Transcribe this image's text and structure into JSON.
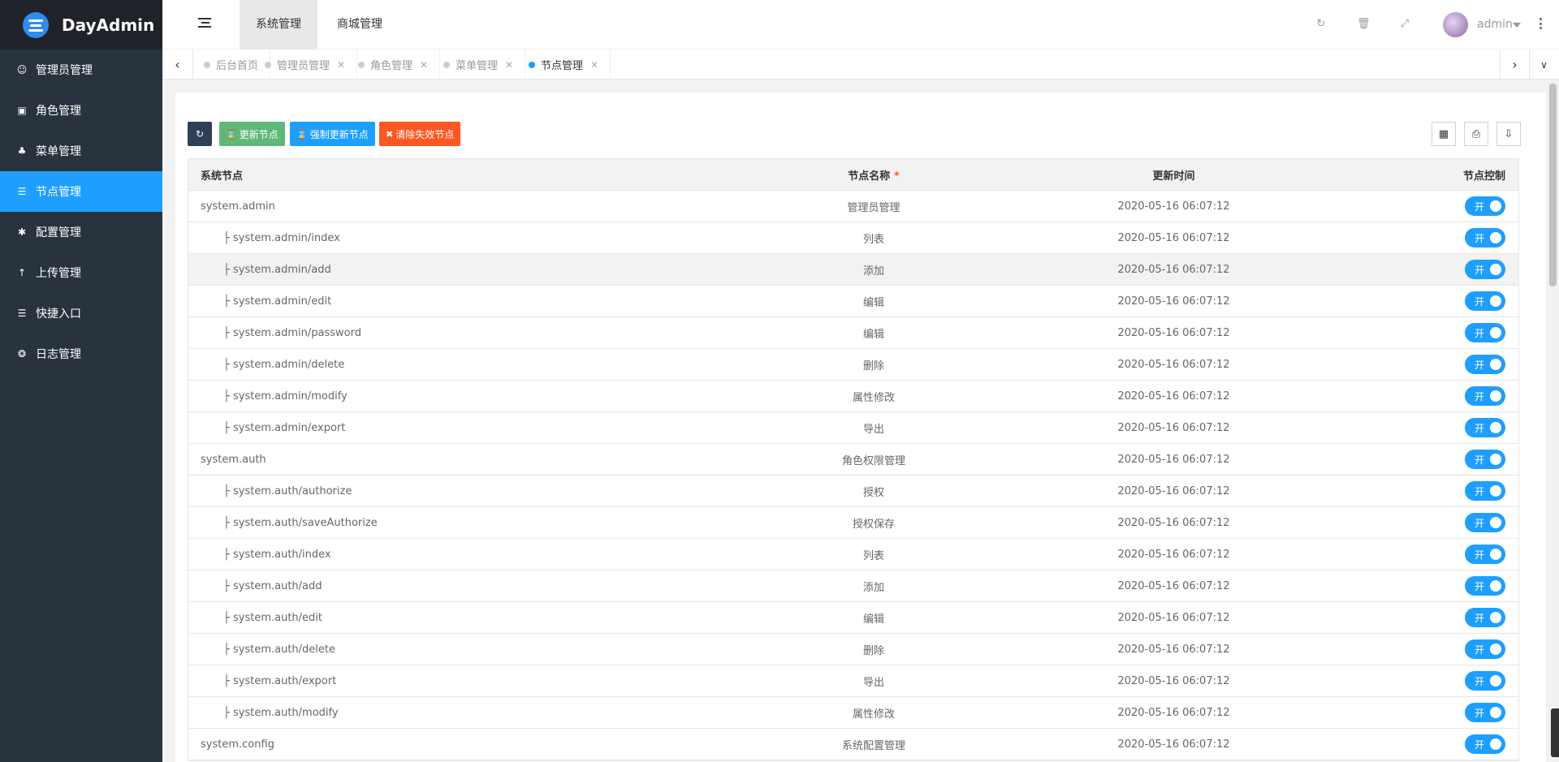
{
  "app": {
    "title": "DayAdmin"
  },
  "sidebar": {
    "items": [
      {
        "label": "管理员管理",
        "icon": "user-icon",
        "glyph": "☺"
      },
      {
        "label": "角色管理",
        "icon": "role-icon",
        "glyph": "▣"
      },
      {
        "label": "菜单管理",
        "icon": "tree-icon",
        "glyph": "♣"
      },
      {
        "label": "节点管理",
        "icon": "list-icon",
        "glyph": "☰",
        "active": true
      },
      {
        "label": "配置管理",
        "icon": "asterisk-icon",
        "glyph": "✱"
      },
      {
        "label": "上传管理",
        "icon": "upload-icon",
        "glyph": "↑"
      },
      {
        "label": "快捷入口",
        "icon": "list-icon",
        "glyph": "☰"
      },
      {
        "label": "日志管理",
        "icon": "globe-icon",
        "glyph": "❂"
      }
    ]
  },
  "header": {
    "tabs": [
      {
        "label": "系统管理",
        "active": true
      },
      {
        "label": "商城管理",
        "active": false
      }
    ],
    "user": {
      "name": "admin"
    }
  },
  "page_tabs": [
    {
      "label": "后台首页",
      "closable": false,
      "active": false
    },
    {
      "label": "管理员管理",
      "closable": true,
      "active": false
    },
    {
      "label": "角色管理",
      "closable": true,
      "active": false
    },
    {
      "label": "菜单管理",
      "closable": true,
      "active": false
    },
    {
      "label": "节点管理",
      "closable": true,
      "active": true
    }
  ],
  "toolbar": {
    "update_label": "更新节点",
    "force_update_label": "强制更新节点",
    "clear_label": "清除失效节点"
  },
  "table": {
    "columns": [
      "系统节点",
      "节点名称",
      "更新时间",
      "节点控制"
    ],
    "required_mark": "*",
    "switch_label": "开",
    "tree_prefix": "├",
    "rows": [
      {
        "node": "system.admin",
        "name": "管理员管理",
        "time": "2020-05-16 06:07:12",
        "child": false
      },
      {
        "node": "system.admin/index",
        "name": "列表",
        "time": "2020-05-16 06:07:12",
        "child": true
      },
      {
        "node": "system.admin/add",
        "name": "添加",
        "time": "2020-05-16 06:07:12",
        "child": true,
        "hover": true
      },
      {
        "node": "system.admin/edit",
        "name": "编辑",
        "time": "2020-05-16 06:07:12",
        "child": true
      },
      {
        "node": "system.admin/password",
        "name": "编辑",
        "time": "2020-05-16 06:07:12",
        "child": true
      },
      {
        "node": "system.admin/delete",
        "name": "删除",
        "time": "2020-05-16 06:07:12",
        "child": true
      },
      {
        "node": "system.admin/modify",
        "name": "属性修改",
        "time": "2020-05-16 06:07:12",
        "child": true
      },
      {
        "node": "system.admin/export",
        "name": "导出",
        "time": "2020-05-16 06:07:12",
        "child": true
      },
      {
        "node": "system.auth",
        "name": "角色权限管理",
        "time": "2020-05-16 06:07:12",
        "child": false
      },
      {
        "node": "system.auth/authorize",
        "name": "授权",
        "time": "2020-05-16 06:07:12",
        "child": true
      },
      {
        "node": "system.auth/saveAuthorize",
        "name": "授权保存",
        "time": "2020-05-16 06:07:12",
        "child": true
      },
      {
        "node": "system.auth/index",
        "name": "列表",
        "time": "2020-05-16 06:07:12",
        "child": true
      },
      {
        "node": "system.auth/add",
        "name": "添加",
        "time": "2020-05-16 06:07:12",
        "child": true
      },
      {
        "node": "system.auth/edit",
        "name": "编辑",
        "time": "2020-05-16 06:07:12",
        "child": true
      },
      {
        "node": "system.auth/delete",
        "name": "删除",
        "time": "2020-05-16 06:07:12",
        "child": true
      },
      {
        "node": "system.auth/export",
        "name": "导出",
        "time": "2020-05-16 06:07:12",
        "child": true
      },
      {
        "node": "system.auth/modify",
        "name": "属性修改",
        "time": "2020-05-16 06:07:12",
        "child": true
      },
      {
        "node": "system.config",
        "name": "系统配置管理",
        "time": "2020-05-16 06:07:12",
        "child": false
      }
    ]
  },
  "colors": {
    "sidebar_bg": "#28333e",
    "logo_bg": "#20222a",
    "accent": "#1e9fff",
    "success": "#5fb878",
    "danger": "#ff5722",
    "dark_button": "#2f4056"
  }
}
